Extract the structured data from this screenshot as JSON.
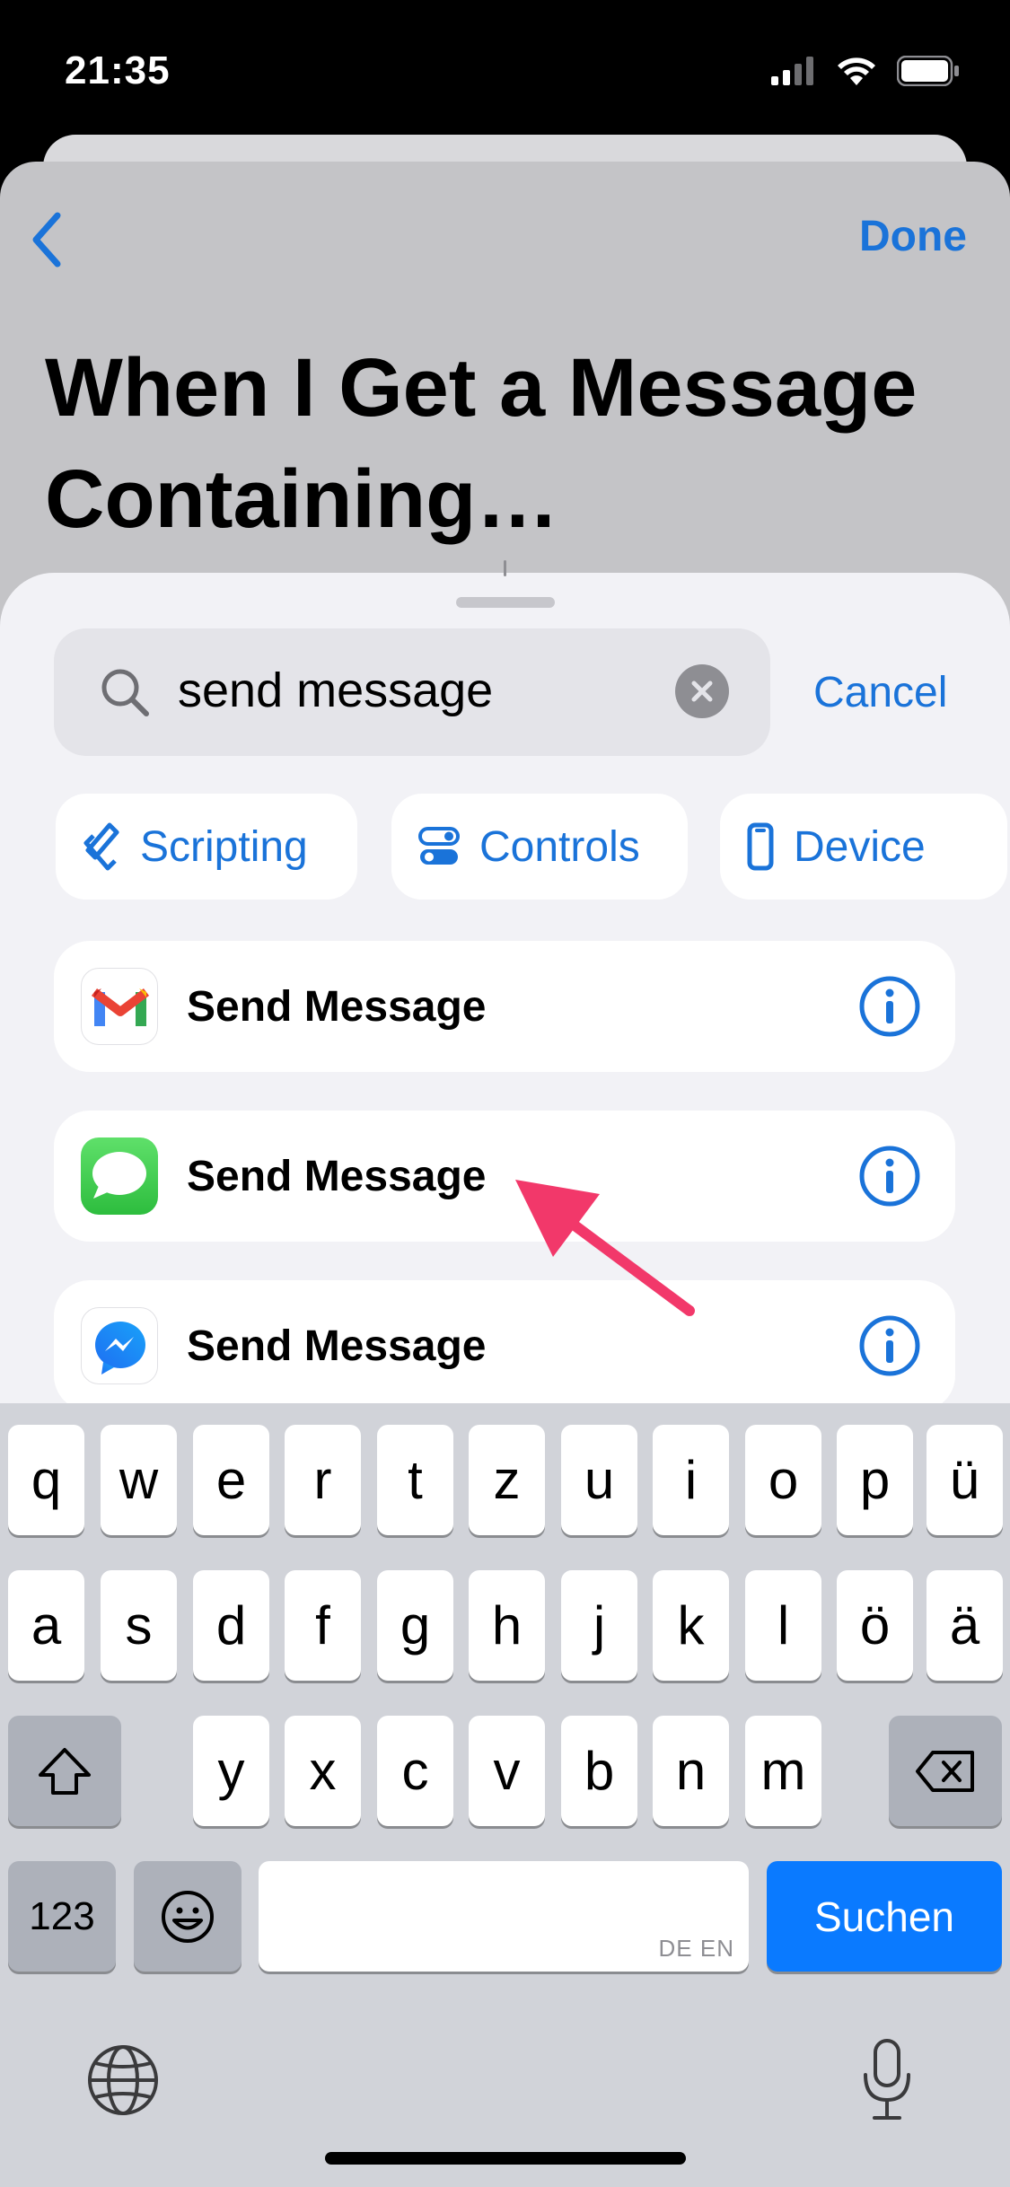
{
  "status_bar": {
    "time": "21:35"
  },
  "header": {
    "done_label": "Done",
    "title": "When I Get a Message Containing…"
  },
  "search": {
    "value": "send message",
    "cancel_label": "Cancel"
  },
  "categories": [
    {
      "label": "Scripting",
      "icon": "scripting-icon"
    },
    {
      "label": "Controls",
      "icon": "toggle-icon"
    },
    {
      "label": "Device",
      "icon": "phone-icon"
    }
  ],
  "results": [
    {
      "label": "Send Message",
      "app": "Gmail",
      "icon": "gmail-icon"
    },
    {
      "label": "Send Message",
      "app": "Messages",
      "icon": "messages-icon"
    },
    {
      "label": "Send Message",
      "app": "Messenger",
      "icon": "messenger-icon"
    }
  ],
  "keyboard": {
    "row1": [
      "q",
      "w",
      "e",
      "r",
      "t",
      "z",
      "u",
      "i",
      "o",
      "p",
      "ü"
    ],
    "row2": [
      "a",
      "s",
      "d",
      "f",
      "g",
      "h",
      "j",
      "k",
      "l",
      "ö",
      "ä"
    ],
    "row3": [
      "y",
      "x",
      "c",
      "v",
      "b",
      "n",
      "m"
    ],
    "numbers_label": "123",
    "search_label": "Suchen",
    "language_hint": "DE EN"
  },
  "colors": {
    "accent": "#1a73d9",
    "key_search": "#0a7aff",
    "annotation_arrow": "#f2386a"
  }
}
